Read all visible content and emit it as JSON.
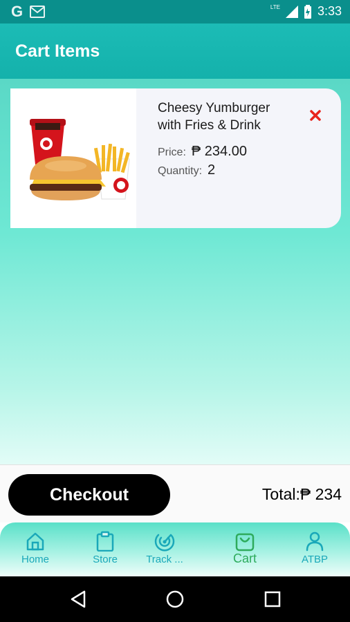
{
  "status_bar": {
    "time": "3:33",
    "network": "LTE",
    "icons": [
      "google-g-icon",
      "gmail-icon",
      "signal-icon",
      "battery-icon"
    ]
  },
  "app_bar": {
    "title": "Cart Items"
  },
  "cart": {
    "items": [
      {
        "name": "Cheesy Yumburger with Fries & Drink",
        "price_label": "Price:",
        "price_value": "₱ 234.00",
        "quantity_label": "Quantity:",
        "quantity_value": "2",
        "image": "burger-meal-image"
      }
    ]
  },
  "checkout": {
    "button_label": "Checkout",
    "total_text": "Total:₱ 234"
  },
  "bottom_nav": {
    "items": [
      {
        "label": "Home",
        "icon": "home-icon"
      },
      {
        "label": "Store",
        "icon": "clipboard-icon"
      },
      {
        "label": "Track ...",
        "icon": "radar-icon"
      },
      {
        "label": "Cart",
        "icon": "shopping-bag-icon",
        "active": true
      },
      {
        "label": "ATBP",
        "icon": "person-icon"
      }
    ]
  },
  "colors": {
    "app_bar": "#14b1ab",
    "accent": "#1aa8b9",
    "active": "#2eab5c",
    "remove": "#e8231b"
  }
}
